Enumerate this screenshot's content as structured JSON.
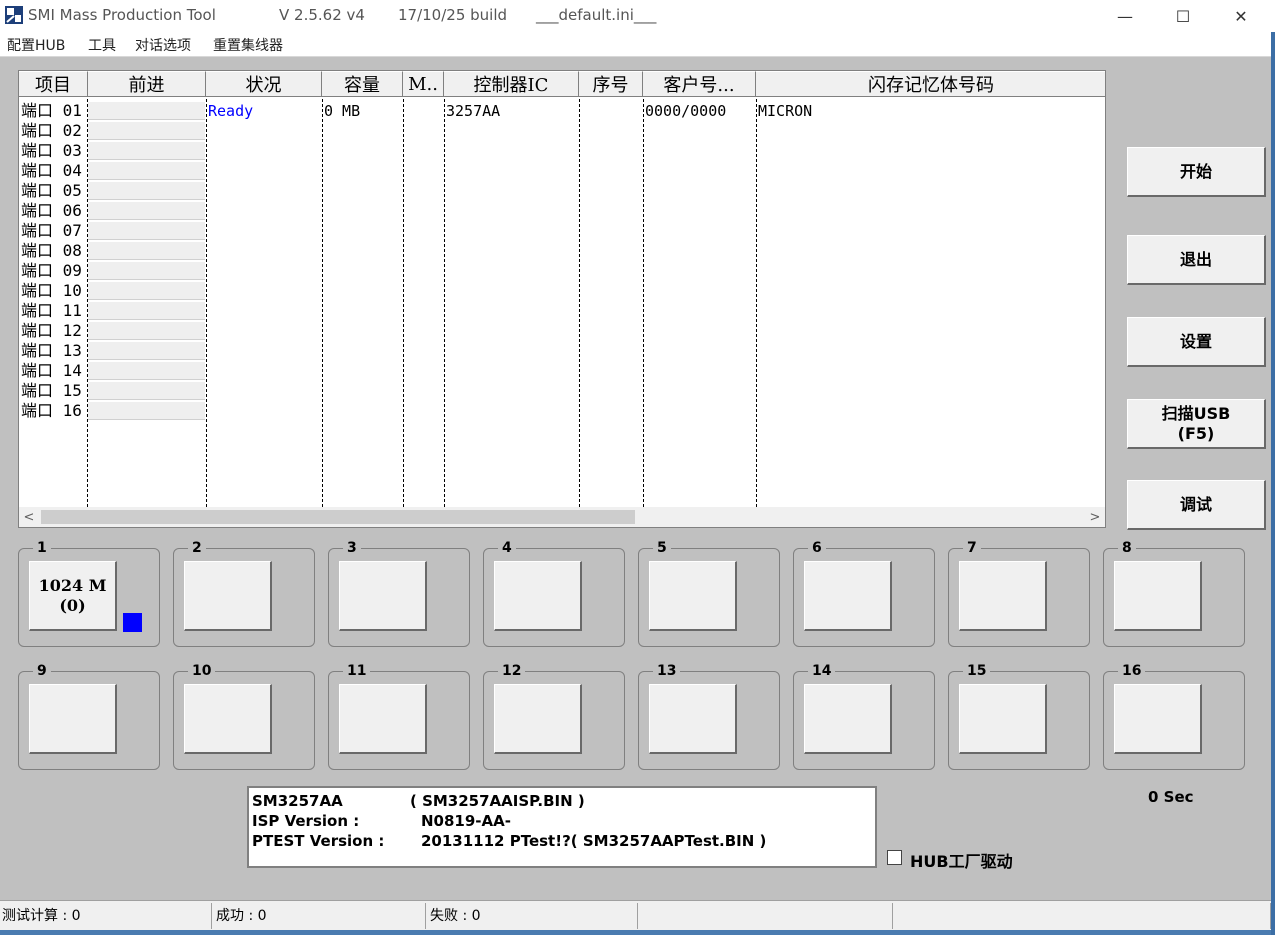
{
  "window": {
    "app_name": "SMI Mass Production Tool",
    "version": "V 2.5.62   v4",
    "build": "17/10/25 build",
    "ini": "___default.ini___",
    "minimize": "—",
    "maximize": "☐",
    "close": "✕"
  },
  "menu": [
    "配置HUB",
    "工具",
    "对话选项",
    "重置集线器"
  ],
  "table": {
    "headers": [
      "项目",
      "前进",
      "状况",
      "容量",
      "M..",
      "控制器IC",
      "序号",
      "客户号...",
      "闪存记忆体号码"
    ],
    "ports": [
      "端口 01",
      "端口 02",
      "端口 03",
      "端口 04",
      "端口 05",
      "端口 06",
      "端口 07",
      "端口 08",
      "端口 09",
      "端口 10",
      "端口 11",
      "端口 12",
      "端口 13",
      "端口 14",
      "端口 15",
      "端口 16"
    ],
    "row1": {
      "status": "Ready",
      "capacity": "0 MB",
      "controller": "3257AA",
      "customer": "0000/0000",
      "flash": "MICRON"
    },
    "scroll_left": "<",
    "scroll_right": ">"
  },
  "buttons": {
    "start": "开始",
    "exit": "退出",
    "settings": "设置",
    "scan": "扫描USB\n(F5)",
    "debug": "调试"
  },
  "port_boxes": [
    {
      "num": "1",
      "line1": "1024 M",
      "line2": "(0)"
    },
    {
      "num": "2"
    },
    {
      "num": "3"
    },
    {
      "num": "4"
    },
    {
      "num": "5"
    },
    {
      "num": "6"
    },
    {
      "num": "7"
    },
    {
      "num": "8"
    },
    {
      "num": "9"
    },
    {
      "num": "10"
    },
    {
      "num": "11"
    },
    {
      "num": "12"
    },
    {
      "num": "13"
    },
    {
      "num": "14"
    },
    {
      "num": "15"
    },
    {
      "num": "16"
    }
  ],
  "info": {
    "chip": "SM3257AA",
    "chip_bin": "( SM3257AAISP.BIN )",
    "isp_label": "ISP Version :",
    "isp_value": "N0819-AA-",
    "ptest_label": "PTEST Version :",
    "ptest_value": "20131112 PTest!?( SM3257AAPTest.BIN )"
  },
  "timer": "0 Sec",
  "hub_driver": "HUB工厂驱动",
  "status": {
    "test_count": "测试计算 : 0",
    "success": "成功 : 0",
    "fail": "失败 : 0"
  },
  "colors": {
    "ready_text": "#0000ff",
    "port_indicator": "#0000ff"
  }
}
